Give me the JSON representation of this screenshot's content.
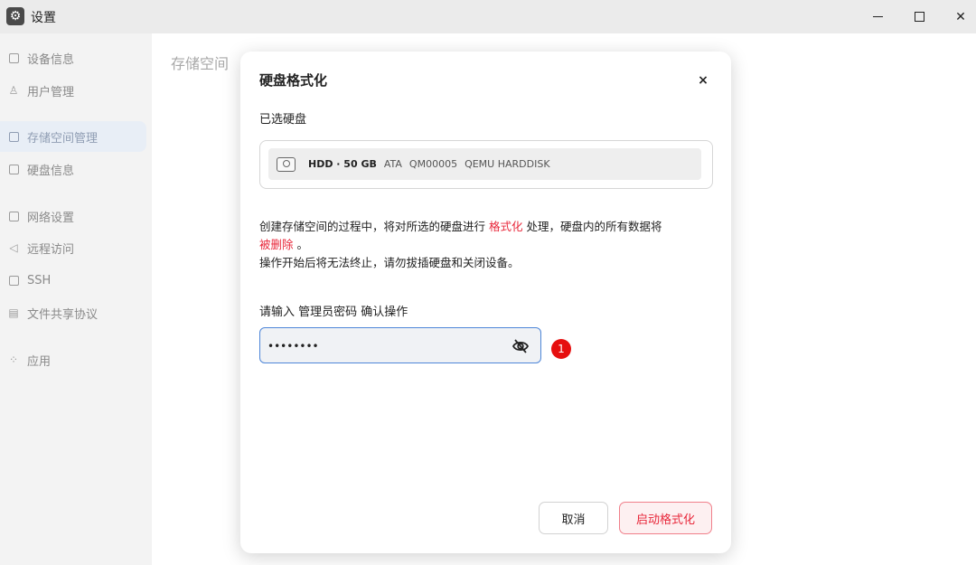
{
  "window": {
    "title": "设置",
    "icon": "gear-icon",
    "controls": {
      "minimize": "minimize-icon",
      "maximize": "maximize-icon",
      "close": "close-icon"
    }
  },
  "sidebar": {
    "items": [
      {
        "label": "设备信息",
        "icon": "device-info-icon",
        "active": false
      },
      {
        "label": "用户管理",
        "icon": "user-icon",
        "active": false
      },
      {
        "label": "存储空间管理",
        "icon": "storage-icon",
        "active": true
      },
      {
        "label": "硬盘信息",
        "icon": "disk-icon",
        "active": false
      },
      {
        "label": "网络设置",
        "icon": "network-icon",
        "active": false
      },
      {
        "label": "远程访问",
        "icon": "remote-icon",
        "active": false
      },
      {
        "label": "SSH",
        "icon": "ssh-icon",
        "active": false
      },
      {
        "label": "文件共享协议",
        "icon": "file-share-icon",
        "active": false
      },
      {
        "label": "应用",
        "icon": "apps-icon",
        "active": false
      }
    ]
  },
  "main": {
    "title": "存储空间"
  },
  "dialog": {
    "title": "硬盘格式化",
    "close_label": "×",
    "selected_label": "已选硬盘",
    "disk": {
      "name": "HDD · 50 GB",
      "interface": "ATA",
      "serial": "QM00005",
      "model": "QEMU HARDDISK"
    },
    "warning": {
      "part1": "创建存储空间的过程中，将对所选的硬盘进行 ",
      "highlight1": "格式化",
      "part2": " 处理，硬盘内的所有数据将",
      "highlight2": "被删除",
      "part3": " 。",
      "line2": "操作开始后将无法终止，请勿拔插硬盘和关闭设备。"
    },
    "password": {
      "label": "请输入 管理员密码 确认操作",
      "value": "••••••••",
      "toggle_icon": "eye-off-icon"
    },
    "marker": "1",
    "buttons": {
      "cancel": "取消",
      "start": "启动格式化"
    }
  },
  "colors": {
    "accent_red": "#e8273a",
    "input_border": "#4e86d8",
    "marker_red": "#e60f0f",
    "sidebar_bg": "#f3f3f3",
    "titlebar_bg": "#ebebeb"
  }
}
